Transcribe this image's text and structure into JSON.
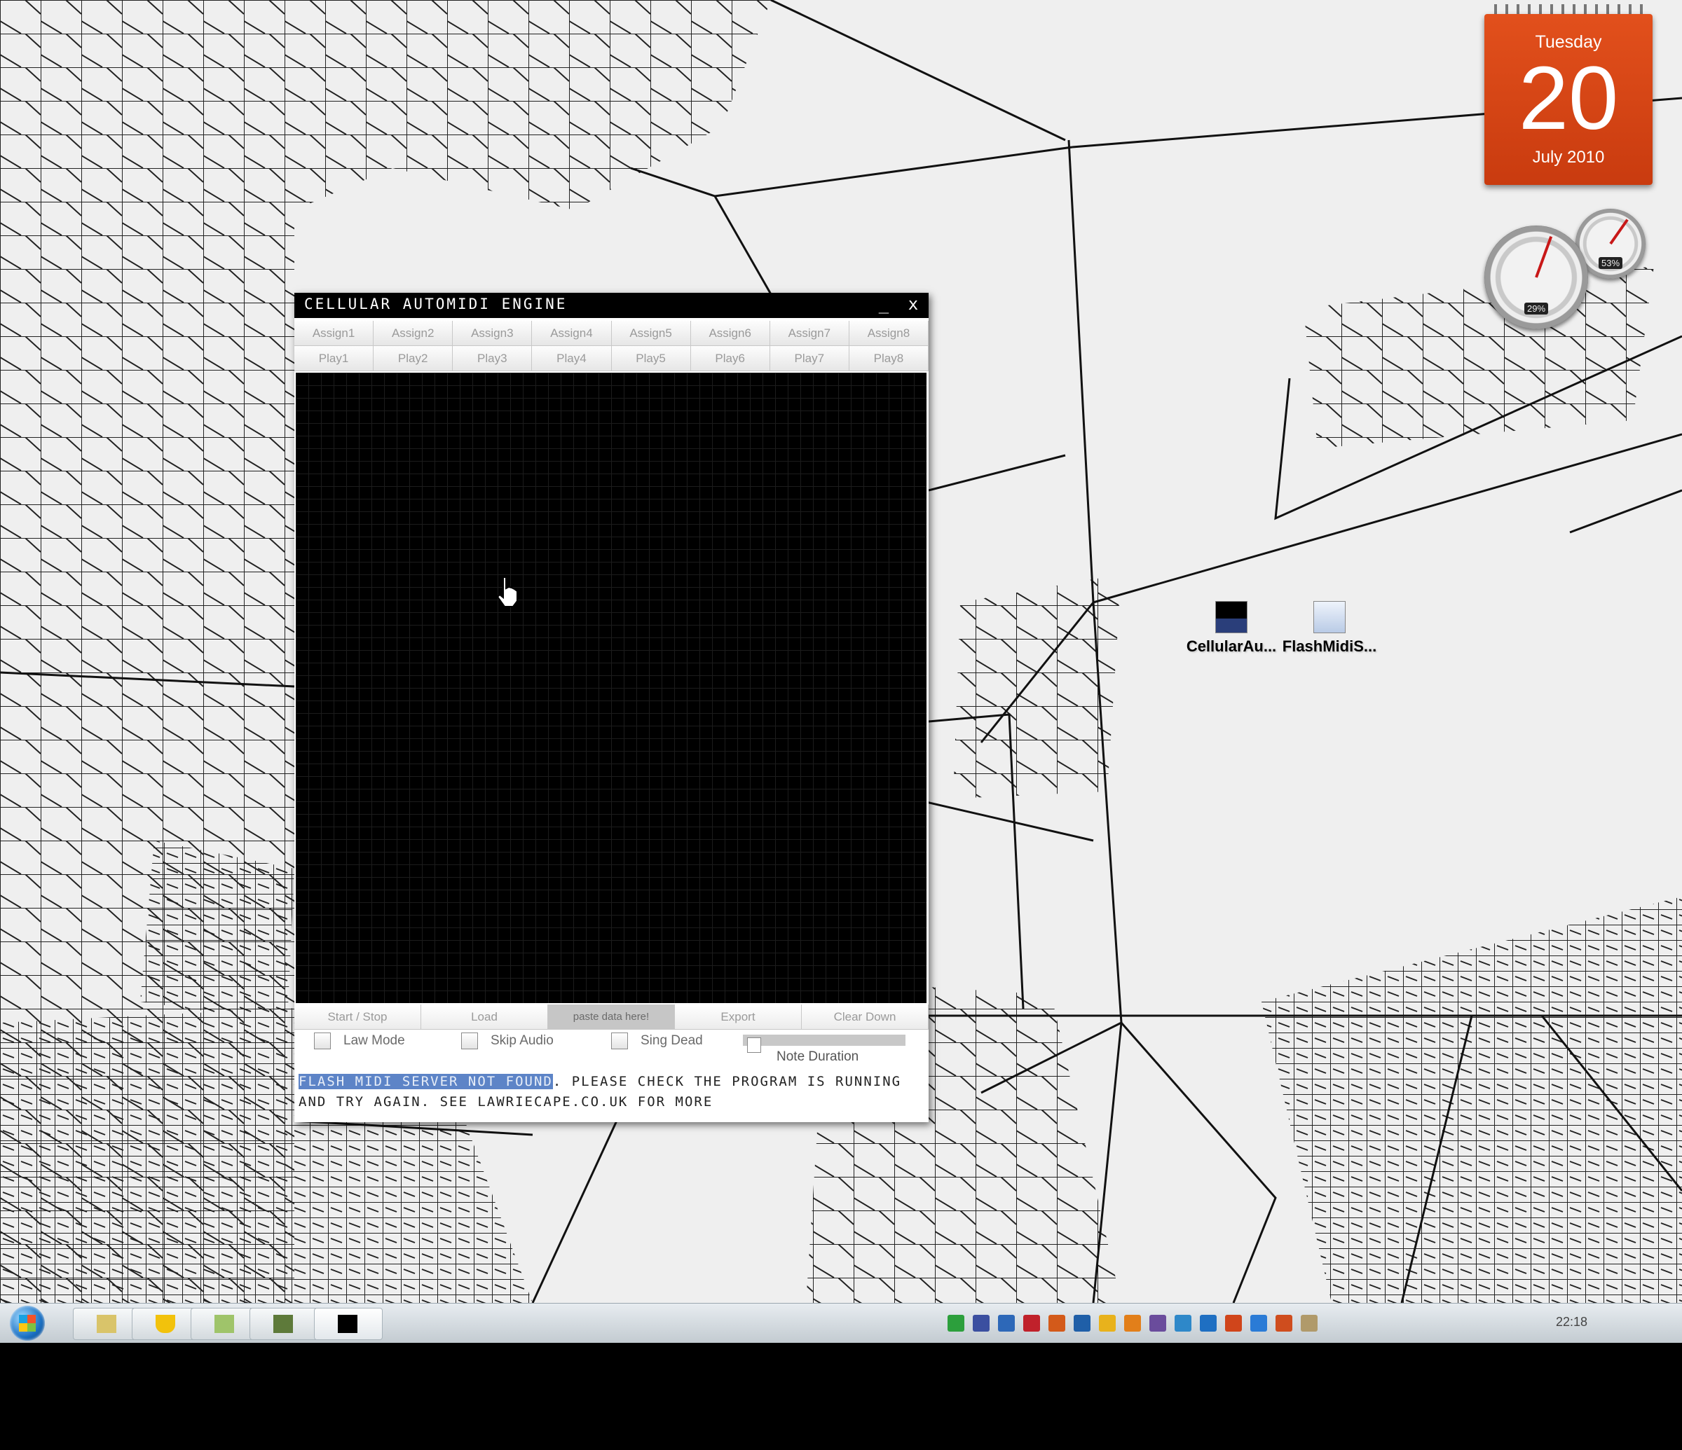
{
  "calendar": {
    "day_name": "Tuesday",
    "date": "20",
    "month_year": "July 2010"
  },
  "meters": {
    "cpu_pct": "29%",
    "mem_pct": "53%"
  },
  "desktop_icons": [
    {
      "label": "CellularAu...",
      "icon": "app-icon"
    },
    {
      "label": "FlashMidiS...",
      "icon": "java-icon"
    }
  ],
  "window": {
    "title": "CELLULAR AUTOMIDI ENGINE",
    "minimize_glyph": "_",
    "close_glyph": "x",
    "assign_buttons": [
      "Assign1",
      "Assign2",
      "Assign3",
      "Assign4",
      "Assign5",
      "Assign6",
      "Assign7",
      "Assign8"
    ],
    "play_buttons": [
      "Play1",
      "Play2",
      "Play3",
      "Play4",
      "Play5",
      "Play6",
      "Play7",
      "Play8"
    ],
    "controls": {
      "start_stop": "Start / Stop",
      "load": "Load",
      "paste": "paste data here!",
      "export": "Export",
      "clear_down": "Clear Down"
    },
    "checkboxes": {
      "law_mode": "Law Mode",
      "skip_audio": "Skip Audio",
      "sing_dead": "Sing Dead"
    },
    "slider_label": "Note Duration",
    "status_highlight": "FLASH MIDI SERVER NOT FOUND",
    "status_rest": ". PLEASE CHECK THE PROGRAM IS RUNNING AND TRY AGAIN. SEE LAWRIECAPE.CO.UK FOR MORE"
  },
  "taskbar": {
    "clock": "22:18",
    "tray_colors": [
      "#2c9f3c",
      "#3b4fa0",
      "#2d68b8",
      "#c0212b",
      "#d35a1a",
      "#1f5fa8",
      "#e8b21c",
      "#e27f1a",
      "#6a4c9c",
      "#2e88c9",
      "#1e6fc2",
      "#d0451b",
      "#2a7bd6",
      "#cf4d1e",
      "#b09a6a"
    ]
  },
  "colors": {
    "calendar": "#d9481a",
    "grid_bg": "#000000",
    "title_bar": "#000000",
    "status_highlight": "#5d84c7"
  }
}
